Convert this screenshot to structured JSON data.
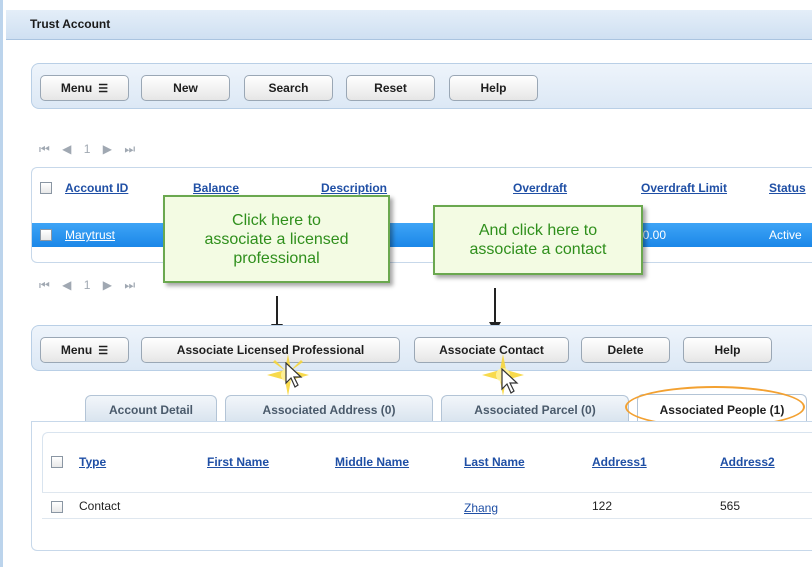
{
  "window": {
    "title": "Trust Account"
  },
  "toolbar_top": {
    "buttons": [
      "Menu",
      "New",
      "Search",
      "Reset",
      "Help"
    ]
  },
  "pager": {
    "first": "⏮",
    "prev": "◀",
    "page": "1",
    "next": "▶",
    "last": "⏭"
  },
  "accounts_table": {
    "columns": [
      "Account ID",
      "Balance",
      "Description",
      "Overdraft",
      "Overdraft Limit",
      "Status"
    ],
    "rows": [
      {
        "account_id": "Marytrust",
        "overdraft_limit": "$0.00",
        "status": "Active"
      }
    ]
  },
  "callouts": {
    "licensed_professional": [
      "Click here to",
      "associate a licensed",
      "professional"
    ],
    "contact": [
      "And click here to",
      "associate a contact"
    ]
  },
  "toolbar_bottom": {
    "buttons": [
      "Menu",
      "Associate Licensed Professional",
      "Associate Contact",
      "Delete",
      "Help"
    ]
  },
  "tabs": [
    {
      "label": "Account Detail",
      "active": false
    },
    {
      "label": "Associated Address (0)",
      "active": false
    },
    {
      "label": "Associated Parcel (0)",
      "active": false
    },
    {
      "label": "Associated People (1)",
      "active": true
    }
  ],
  "people_table": {
    "columns": [
      "Type",
      "First Name",
      "Middle Name",
      "Last Name",
      "Address1",
      "Address2"
    ],
    "rows": [
      {
        "type": "Contact",
        "first_name": "",
        "middle_name": "",
        "last_name": "Zhang",
        "address1": "122",
        "address2": "565"
      }
    ]
  },
  "colors": {
    "highlight_oval": "#f3a131",
    "callout_text": "#2f8f1c",
    "selected_row": "#1b87e8"
  }
}
